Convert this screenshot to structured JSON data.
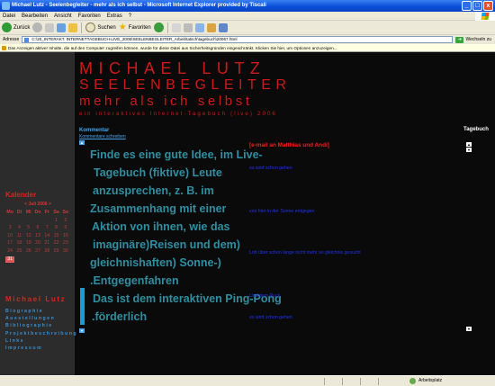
{
  "window": {
    "title": "Michael Lutz - Seelenbegleiter - mehr als ich selbst - Microsoft Internet Explorer provided by Tiscali",
    "controls": [
      "_",
      "□",
      "x"
    ]
  },
  "menu": [
    "Datei",
    "Bearbeiten",
    "Ansicht",
    "Favoriten",
    "Extras",
    "?"
  ],
  "toolbar": {
    "back_label": "Zurück",
    "search_label": "Suchen",
    "favorites_label": "Favoriten"
  },
  "address": {
    "label": "Adresse",
    "url": "C:\\20_INTERAKT. INTERNETTAGEBUCH-LIVE_2005\\SEELENBEGLEITER_Arbeit\\tatsch\\tagebuch\\20067.html",
    "go_label": "Wechseln zu"
  },
  "infobar": "Das Anzeigen aktiver Inhalte, die auf den Computer zugreifen können, wurde für diese Datei aus Sicherheitsgründen eingeschränkt. Klicken Sie hier, um Optionen anzuzeigen...",
  "status": {
    "left": "",
    "zone": "Arbeitsplatz"
  },
  "header": {
    "title": "MICHAEL LUTZ",
    "subtitle": "SEELENBEGLEITER",
    "tagline": "mehr als ich selbst",
    "subtag": "ein interaktives Internet-Tagebuch (live) 2006"
  },
  "kommentar": {
    "title": "Kommentar",
    "link": "Kommentare schreiben"
  },
  "tagebuch": "Tagebuch",
  "main_text": [
    "Finde es eine gute Idee, im Live-",
    "Tagebuch (fiktive) Leute",
    "anzusprechen, z. B. im",
    "Zusammenhang mit einer",
    "Aktion von ihnen, wie das",
    "imaginäre)Reisen und dem)",
    "gleichnishaften) Sonne-)",
    ".Entgegenfahren",
    "Das ist dem interaktiven Ping-Pong",
    ".förderlich"
  ],
  "notes": {
    "red": "[e-mail an Matthias und Andi]",
    "blue": [
      "es wird schon gehen",
      "von hier in der Sonne entgegen",
      "Lob über schon lange nicht mehr so gleichnis gesucht",
      "Und dem Ruck",
      "es wird schon gehen"
    ]
  },
  "kalender": {
    "title": "Kalender",
    "month": "< Juli 2006 >",
    "weekdays": [
      "Mo",
      "Di",
      "Mi",
      "Do",
      "Fr",
      "Sa",
      "So"
    ],
    "days": [
      "",
      "",
      "",
      "",
      "",
      "1",
      "2",
      "3",
      "4",
      "5",
      "6",
      "7",
      "8",
      "9",
      "10",
      "11",
      "12",
      "13",
      "14",
      "15",
      "16",
      "17",
      "18",
      "19",
      "20",
      "21",
      "22",
      "23",
      "24",
      "25",
      "26",
      "27",
      "28",
      "29",
      "30",
      "31",
      "",
      "",
      "",
      "",
      "",
      ""
    ],
    "selected": "31"
  },
  "nav": {
    "title": "Michael Lutz",
    "items": [
      "Biographie",
      "Ausstellungen",
      "Bibliographie",
      "Projektbeschreibung",
      "Links",
      "Impressum"
    ]
  },
  "colors": {
    "accent_red": "#cc1a1a",
    "accent_blue": "#49a3e6",
    "text_teal": "#2f8ea0",
    "note_blue": "#2233ee"
  }
}
